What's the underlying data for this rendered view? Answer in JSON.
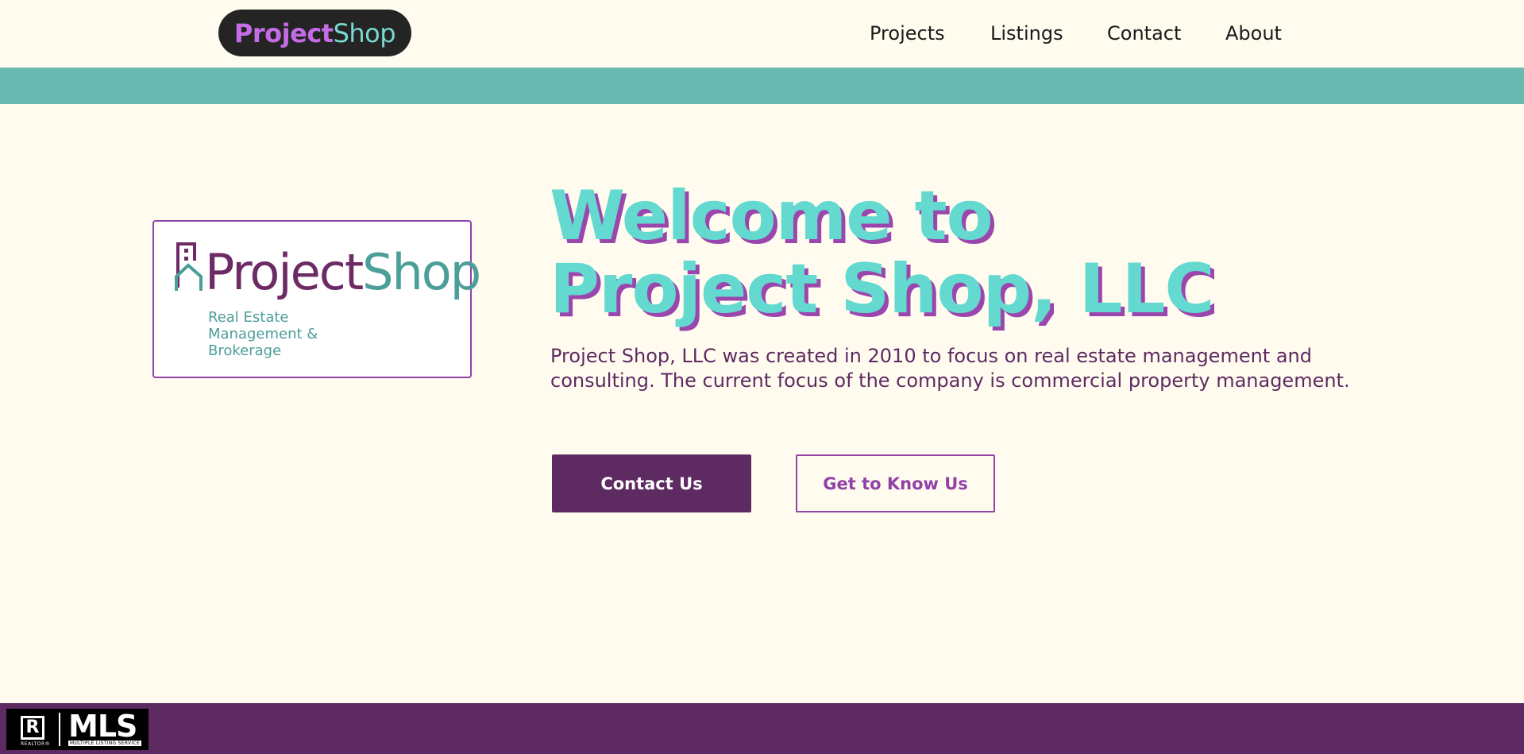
{
  "header": {
    "brand_primary": "Project",
    "brand_secondary": "Shop",
    "nav": [
      {
        "label": "Projects"
      },
      {
        "label": "Listings"
      },
      {
        "label": "Contact"
      },
      {
        "label": "About"
      }
    ]
  },
  "logo": {
    "word_primary": "Project",
    "word_secondary": "Shop",
    "tagline": "Real Estate Management & Brokerage"
  },
  "hero": {
    "title_line1": "Welcome to",
    "title_line2": "Project Shop, LLC",
    "description": "Project Shop, LLC was created in 2010 to focus on real estate management and consulting. The current focus of the company is commercial property management.",
    "primary_button": "Contact Us",
    "secondary_button": "Get to Know Us"
  },
  "footer": {
    "badge_left": "R",
    "badge_left_caption": "REALTOR®",
    "badge_main": "MLS",
    "badge_caption": "MULTIPLE LISTING SERVICE"
  },
  "colors": {
    "background": "#fffcef",
    "teal_band": "#69b9b1",
    "purple_dark": "#5e2a62",
    "purple_accent": "#9340a8",
    "title_teal": "#63d9cf"
  }
}
